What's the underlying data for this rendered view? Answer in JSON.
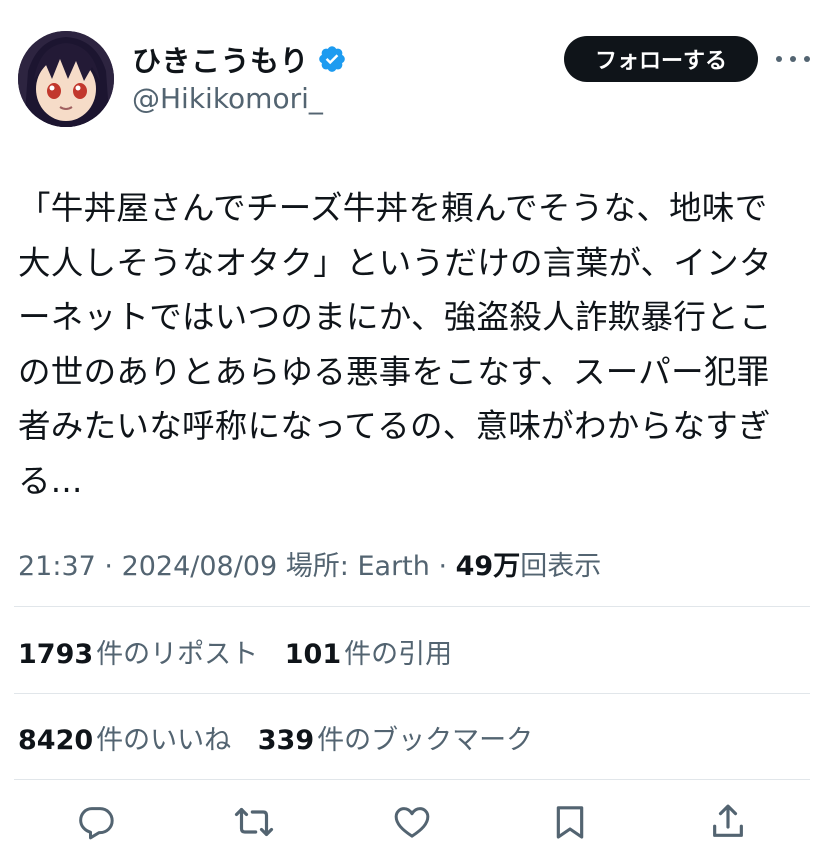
{
  "author": {
    "display_name": "ひきこうもり",
    "handle": "@Hikikomori_",
    "verified": true,
    "verified_color": "#1d9bf0"
  },
  "header": {
    "follow_label": "フォローする"
  },
  "tweet": {
    "text": "「牛丼屋さんでチーズ牛丼を頼んでそうな、地味で\n大人しそうなオタク」というだけの言葉が、インタ\nーネットではいつのまにか、強盗殺人詐欺暴行とこ\nの世のありとあらゆる悪事をこなす、スーパー犯罪\n者みたいな呼称になってるの、意味がわからなすぎ\nる..."
  },
  "meta": {
    "time": "21:37",
    "separator": " · ",
    "date": "2024/08/09",
    "location": "場所: Earth",
    "views_count": "49万",
    "views_label": "回表示"
  },
  "stats": {
    "reposts": {
      "count": "1793",
      "label": "件のリポスト"
    },
    "quotes": {
      "count": "101",
      "label": "件の引用"
    },
    "likes": {
      "count": "8420",
      "label": "件のいいね"
    },
    "bookmarks": {
      "count": "339",
      "label": "件のブックマーク"
    }
  },
  "actions": [
    "reply-icon",
    "repost-icon",
    "like-icon",
    "bookmark-icon",
    "share-icon"
  ],
  "colors": {
    "text": "#0f1419",
    "secondary": "#536471",
    "divider": "#e1e6ea",
    "button_bg": "#0f1419"
  }
}
